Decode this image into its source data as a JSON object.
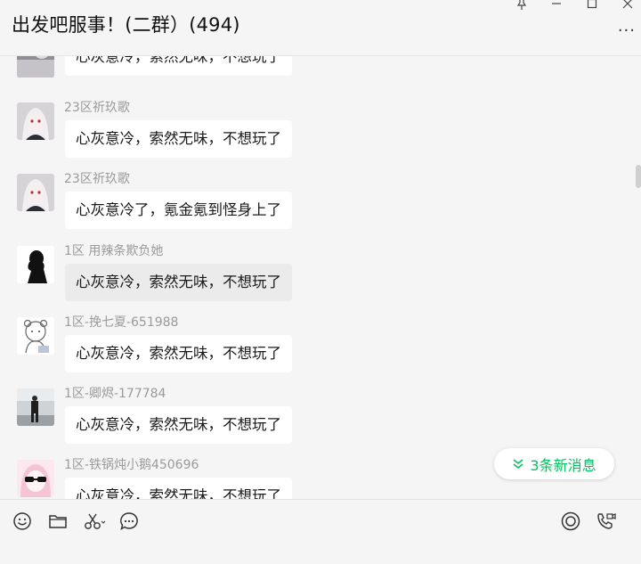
{
  "window": {
    "title": "出发吧服事！(二群）(494)",
    "more_label": "···"
  },
  "messages": [
    {
      "sender": "",
      "text": "心灰意冷，索然无味，不想玩了",
      "avatar": "partial-avatar"
    },
    {
      "sender": "23区祈玖歌",
      "text": "心灰意冷，索然无味，不想玩了",
      "avatar": "anime-girl-avatar"
    },
    {
      "sender": "23区祈玖歌",
      "text": "心灰意冷了，氪金氪到怪身上了",
      "avatar": "anime-girl-avatar"
    },
    {
      "sender": "1区 用辣条欺负她",
      "text": "心灰意冷，索然无味，不想玩了",
      "avatar": "silhouette-avatar"
    },
    {
      "sender": "1区-挽七夏-651988",
      "text": "心灰意冷，索然无味，不想玩了",
      "avatar": "bear-sketch-avatar"
    },
    {
      "sender": "1区-卿烬-177784",
      "text": "心灰意冷，索然无味，不想玩了",
      "avatar": "photo-person-avatar"
    },
    {
      "sender": "1区-铁锅炖小鹅450696",
      "text": "心灰意冷，索然无味，不想玩了",
      "avatar": "sunglasses-girl-avatar"
    }
  ],
  "new_messages": {
    "label": "3条新消息",
    "icon": "double-chevron-down-icon",
    "color": "#07c160"
  },
  "toolbar": {
    "left": [
      "emoji-icon",
      "folder-icon",
      "scissors-icon",
      "chat-bubble-icon"
    ],
    "right": [
      "record-icon",
      "phone-video-icon"
    ]
  },
  "colors": {
    "background": "#f5f5f5",
    "bubble": "#ffffff",
    "bubble_hover": "#ebebeb",
    "sender_name": "#9a9a9a",
    "accent": "#07c160"
  }
}
